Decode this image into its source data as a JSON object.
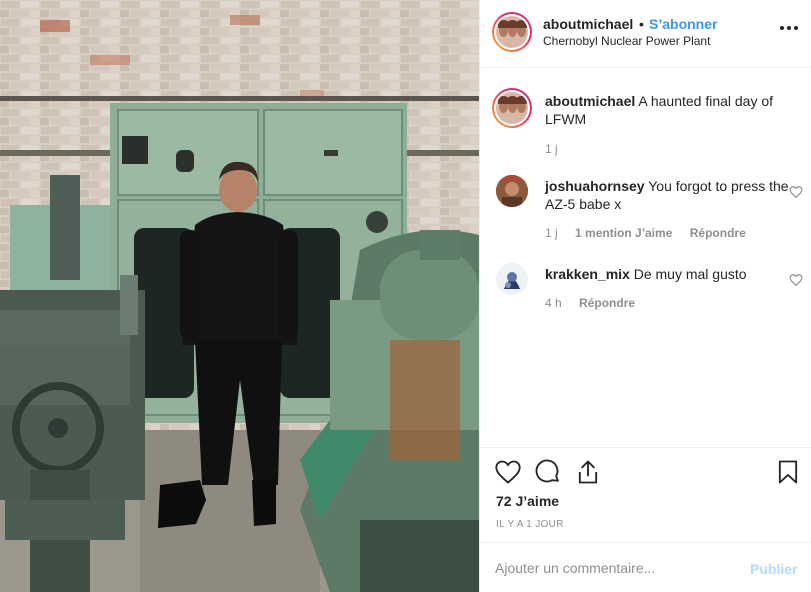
{
  "post": {
    "username": "aboutmichael",
    "separator": "•",
    "follow_label": "S’abonner",
    "location": "Chernobyl Nuclear Power Plant",
    "more_icon": "more-horizontal-icon"
  },
  "caption": {
    "username": "aboutmichael",
    "text": "A haunted final day of LFWM",
    "time": "1 j"
  },
  "comments": [
    {
      "username": "joshuahornsey",
      "text": "You forgot to press the AZ-5 babe x",
      "time": "1 j",
      "likes": "1 mention J’aime",
      "reply": "Répondre"
    },
    {
      "username": "krakken_mix",
      "text": "De muy mal gusto",
      "time": "4 h",
      "reply": "Répondre"
    }
  ],
  "actions": {
    "like_icon": "heart-icon",
    "comment_icon": "comment-icon",
    "share_icon": "share-icon",
    "save_icon": "bookmark-icon",
    "likes_count": "72 J’aime",
    "timestamp": "IL Y A 1 JOUR"
  },
  "add_comment": {
    "placeholder": "Ajouter un commentaire...",
    "publish_label": "Publier"
  },
  "colors": {
    "accent": "#3897f0",
    "publish_disabled": "#b3dbff",
    "text": "#262626",
    "muted": "#8e8e8e"
  }
}
